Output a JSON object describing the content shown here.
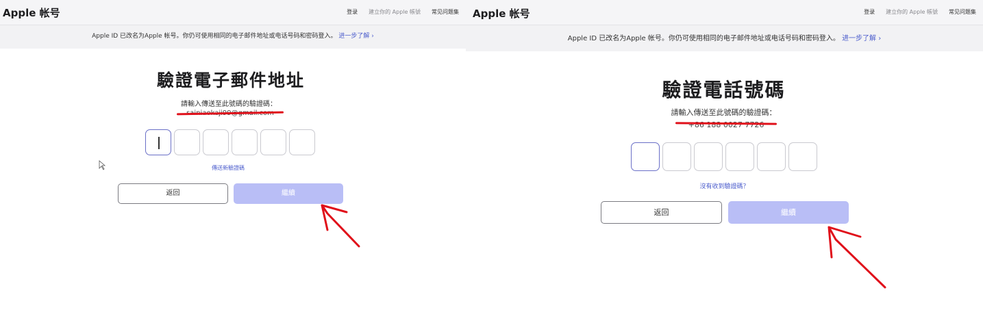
{
  "colors": {
    "accent": "#4b5ccc",
    "continue_disabled": "#b9bef6",
    "annotation_red": "#e0101a"
  },
  "left": {
    "header": {
      "brand": "Apple 帐号",
      "nav": [
        "登录",
        "建立你的 Apple 帳號",
        "常见问题集"
      ]
    },
    "banner": {
      "text": "Apple ID 已改名为Apple 帐号。你仍可使用相同的电子邮件地址或电话号码和密码登入。",
      "link": "进一步了解 ›"
    },
    "title": "驗證電子郵件地址",
    "subtitle": "請輸入傳送至此號碼的驗證碼：",
    "masked_value": "sainiaokaji99@gmail.com",
    "code_digits": [
      "",
      "",
      "",
      "",
      "",
      ""
    ],
    "resend": "傳送新驗證碼",
    "back_label": "返回",
    "continue_label": "繼續"
  },
  "right": {
    "header": {
      "brand": "Apple 帐号",
      "nav": [
        "登录",
        "建立你的 Apple 帳號",
        "常见问题集"
      ]
    },
    "banner": {
      "text": "Apple ID 已改名为Apple 帐号。你仍可使用相同的电子邮件地址或电话号码和密码登入。",
      "link": "进一步了解 ›"
    },
    "title": "驗證電話號碼",
    "subtitle": "請輸入傳送至此號碼的驗證碼：",
    "masked_value": "+86 188 0027 7726",
    "code_digits": [
      "",
      "",
      "",
      "",
      "",
      ""
    ],
    "resend": "沒有收到驗證碼？",
    "back_label": "返回",
    "continue_label": "繼續"
  }
}
